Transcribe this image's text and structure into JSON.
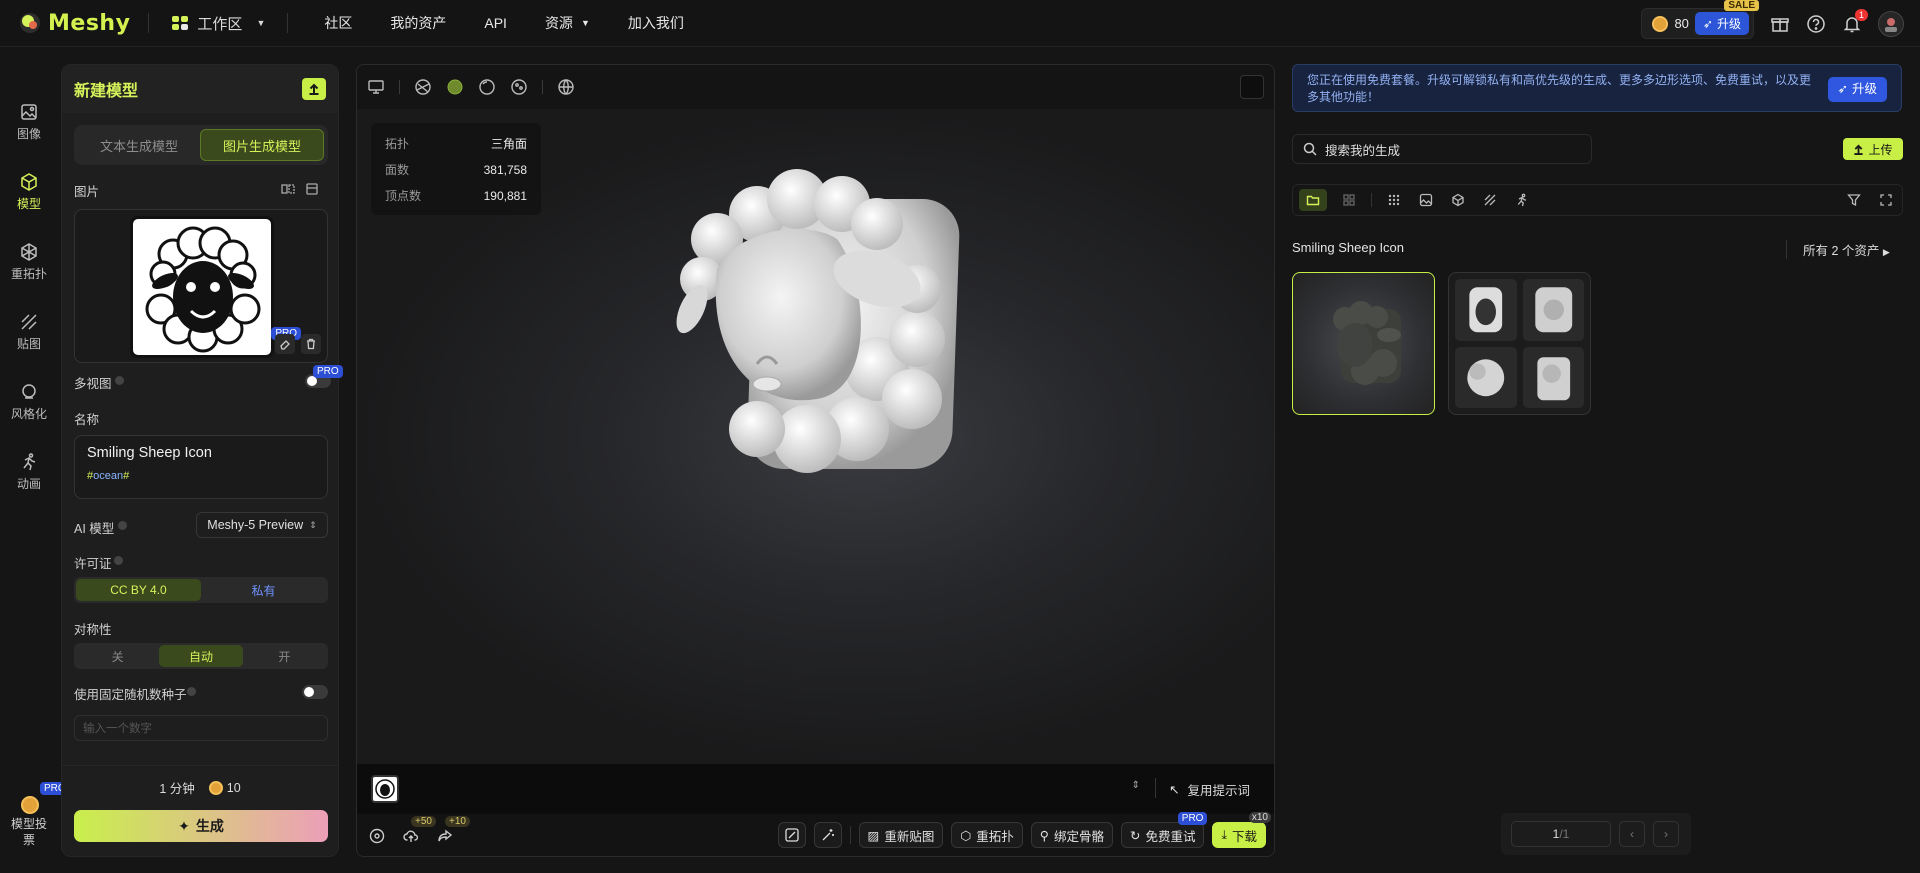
{
  "app": {
    "name": "Meshy"
  },
  "topnav": {
    "workspace": "工作区",
    "items": [
      "社区",
      "我的资产",
      "API",
      "资源",
      "加入我们"
    ],
    "credits": "80",
    "upgrade": "升级",
    "sale": "SALE",
    "notifications": "1"
  },
  "rail": {
    "items": [
      "图像",
      "模型",
      "重拓扑",
      "贴图",
      "风格化",
      "动画"
    ],
    "bottom_label": "模型投票",
    "bottom_pro": "PRO"
  },
  "panel": {
    "title": "新建模型",
    "tabs": [
      "文本生成模型",
      "图片生成模型"
    ],
    "image_label": "图片",
    "pro": "PRO",
    "multiview_label": "多视图",
    "name_label": "名称",
    "name_value": "Smiling Sheep Icon",
    "tag_hash": "#",
    "tag_text": "ocean",
    "ai_model_label": "AI 模型",
    "ai_model_value": "Meshy-5 Preview",
    "license_label": "许可证",
    "license_options": [
      "CC BY 4.0",
      "私有"
    ],
    "symmetry_label": "对称性",
    "symmetry_options": [
      "关",
      "自动",
      "开"
    ],
    "seed_label": "使用固定随机数种子",
    "seed_placeholder": "输入一个数字",
    "time": "1 分钟",
    "cost": "10",
    "generate": "生成"
  },
  "viewer": {
    "stats": [
      {
        "k": "拓扑",
        "v": "三角面"
      },
      {
        "k": "面数",
        "v": "381,758"
      },
      {
        "k": "顶点数",
        "v": "190,881"
      }
    ],
    "reuse_prompt": "复用提示词",
    "plus50": "+50",
    "plus10": "+10",
    "actions": [
      "重新贴图",
      "重拓扑",
      "绑定骨骼",
      "免费重试",
      "下载"
    ],
    "pro": "PRO",
    "x10": "x10"
  },
  "right": {
    "notice": "您正在使用免费套餐。升级可解锁私有和高优先级的生成、更多多边形选项、免费重试，以及更多其他功能！",
    "notice_btn": "升级",
    "search_placeholder": "搜索我的生成",
    "upload": "上传",
    "group_title": "Smiling Sheep Icon",
    "all_assets": "所有 2 个资产",
    "page": "1",
    "page_total": "/1"
  },
  "colors": {
    "accent": "#d6f25a",
    "pro": "#2d4fd6",
    "upgrade": "#2f57e0"
  }
}
